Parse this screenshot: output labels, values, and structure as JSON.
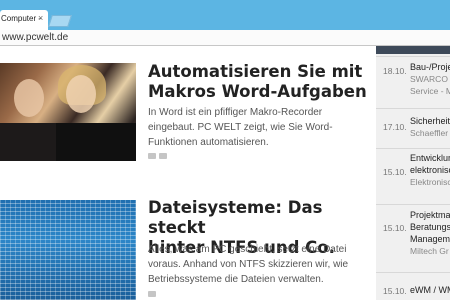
{
  "browser": {
    "tab_title": "Computer -",
    "tab_close": "×",
    "address": "www.pcwelt.de"
  },
  "articles": [
    {
      "title_line1": "Automatisieren Sie mit",
      "title_line2": "Makros Word-Aufgaben",
      "teaser_line1": "In Word ist ein pfiffiger Makro-Recorder",
      "teaser_line2": "eingebaut. PC WELT zeigt, wie Sie Word-",
      "teaser_line3": "Funktionen automatisieren."
    },
    {
      "title_line1": "Dateisysteme: Das steckt",
      "title_line2": "hinter NTFS und Co.",
      "teaser_line1": "Alles, was am PC geschieht, setzt eine Datei",
      "teaser_line2": "voraus. Anhand von NTFS skizzieren wir, wie",
      "teaser_line3": "Betriebssysteme die Dateien verwalten."
    }
  ],
  "sidebar": {
    "items": [
      {
        "date": "18.10.",
        "line1": "Bau-/Projekt",
        "line2": "SWARCO V",
        "line3": "Service - M"
      },
      {
        "date": "17.10.",
        "line1": "Sicherheits",
        "line2": "Schaeffler T"
      },
      {
        "date": "15.10.",
        "line1": "Entwicklung",
        "line2": "elektronisch",
        "line3": "Elektronisch"
      },
      {
        "date": "15.10.",
        "line1": "Projektman",
        "line2": "Beratungsp",
        "line3": "Manageme",
        "line4": "Miltech Gr"
      },
      {
        "date": "15.10.",
        "line1": "eWM / WM"
      }
    ]
  }
}
